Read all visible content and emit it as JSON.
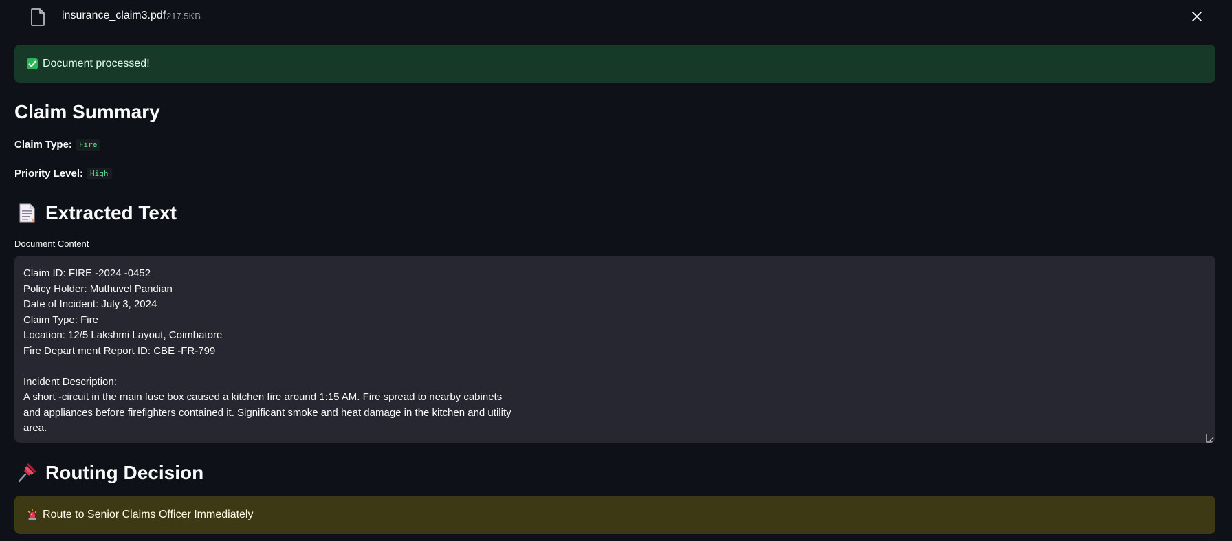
{
  "file": {
    "name": "insurance_claim3.pdf",
    "size": "217.5KB",
    "icon": "file-icon",
    "close_icon": "close-icon"
  },
  "success_alert": {
    "icon": "check-icon",
    "text": "Document processed!",
    "color": "#173928"
  },
  "summary": {
    "title": "Claim Summary",
    "claim_type_label": "Claim Type:",
    "claim_type_value": "Fire",
    "priority_label": "Priority Level:",
    "priority_value": "High"
  },
  "extracted": {
    "icon": "page-with-curl-icon",
    "title": "Extracted Text",
    "field_label": "Document Content",
    "lines": [
      "Claim ID: FIRE -2024 -0452",
      "Policy Holder: Muthuvel Pandian",
      "Date of Incident: July 3, 2024",
      "Claim Type: Fire",
      "Location: 12/5 Lakshmi Layout, Coimbatore",
      "Fire Depart ment Report ID: CBE -FR-799",
      "",
      "Incident Description:",
      "A short -circuit in the main fuse box caused a kitchen fire around 1:15 AM. Fire spread to nearby cabinets",
      "and appliances before firefighters contained it. Significant smoke and heat damage in the kitchen and utility",
      "area."
    ]
  },
  "routing": {
    "icon": "pushpin-icon",
    "title": "Routing Decision",
    "alert_icon": "siren-icon",
    "alert_text": "Route to Senior Claims Officer Immediately",
    "color": "#3e3915"
  }
}
